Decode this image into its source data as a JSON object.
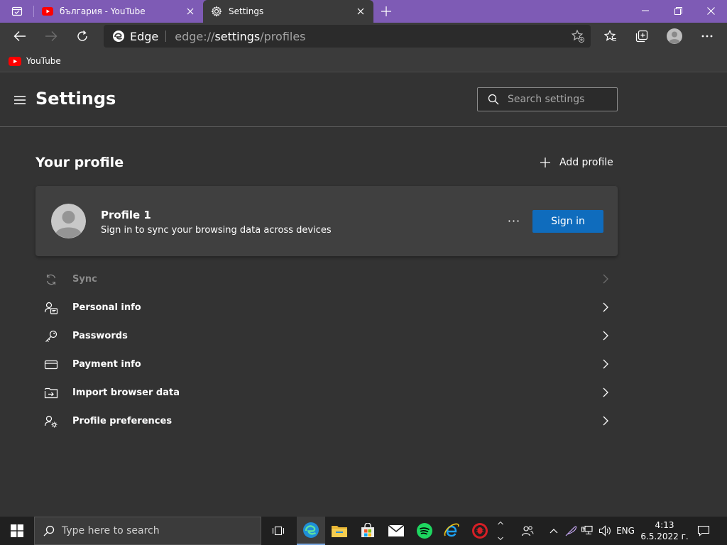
{
  "colors": {
    "titlebar": "#7e5bb5",
    "toolbar": "#3b3b3b",
    "page_bg": "#333333",
    "card_bg": "#404040",
    "accent_button": "#0f6cbd",
    "youtube_red": "#ff0000"
  },
  "tabs": [
    {
      "title": "българия - YouTube",
      "icon": "youtube-icon",
      "active": false
    },
    {
      "title": "Settings",
      "icon": "gear-icon",
      "active": true
    }
  ],
  "address_bar": {
    "site_label": "Edge",
    "url_prefix": "edge://",
    "url_host": "settings",
    "url_path": "/profiles"
  },
  "favorites": [
    {
      "label": "YouTube",
      "icon": "youtube-icon"
    }
  ],
  "settings": {
    "title": "Settings",
    "search_placeholder": "Search settings"
  },
  "profile_section": {
    "title": "Your profile",
    "add_profile_label": "Add profile",
    "profile_name": "Profile 1",
    "profile_description": "Sign in to sync your browsing data across devices",
    "sign_in_label": "Sign in",
    "more_label": "···"
  },
  "menu_items": [
    {
      "label": "Sync",
      "icon": "sync-icon",
      "disabled": true
    },
    {
      "label": "Personal info",
      "icon": "personal-info-icon",
      "disabled": false
    },
    {
      "label": "Passwords",
      "icon": "key-icon",
      "disabled": false
    },
    {
      "label": "Payment info",
      "icon": "credit-card-icon",
      "disabled": false
    },
    {
      "label": "Import browser data",
      "icon": "import-icon",
      "disabled": false
    },
    {
      "label": "Profile preferences",
      "icon": "profile-preferences-icon",
      "disabled": false
    }
  ],
  "taskbar": {
    "search_placeholder": "Type here to search",
    "language": "ENG",
    "time": "4:13",
    "date": "6.5.2022 г."
  }
}
